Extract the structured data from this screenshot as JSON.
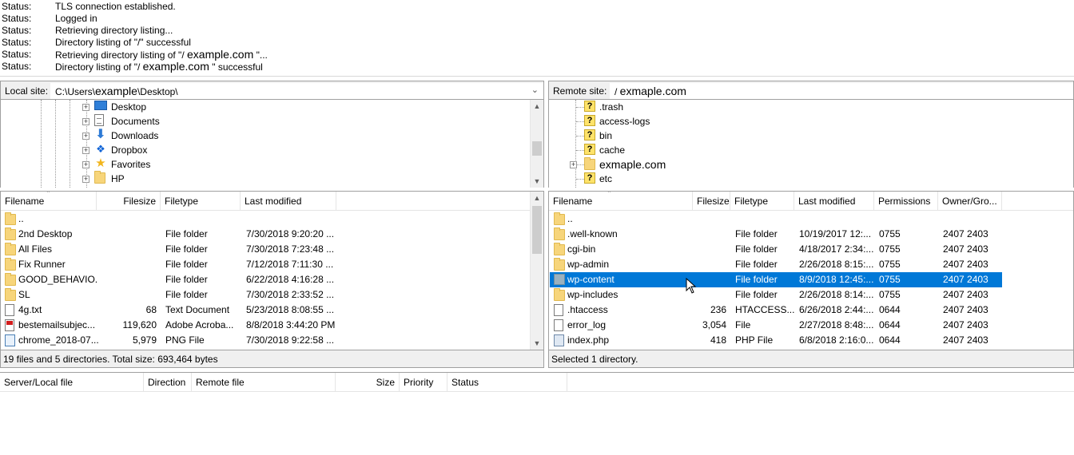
{
  "log": [
    {
      "label": "Status:",
      "msg": "TLS connection established."
    },
    {
      "label": "Status:",
      "msg": "Logged in"
    },
    {
      "label": "Status:",
      "msg": "Retrieving directory listing..."
    },
    {
      "label": "Status:",
      "msg": "Directory listing of \"/\" successful"
    },
    {
      "label": "Status:",
      "pre": "Retrieving directory listing of \"/ ",
      "domain": "example.com",
      "post": "  \"..."
    },
    {
      "label": "Status:",
      "pre": "Directory listing of \"/ ",
      "domain": "example.com",
      "post": "  \" successful"
    }
  ],
  "local": {
    "site_label": "Local site:",
    "path_prefix": "C:\\Users\\",
    "path_user": "example",
    "path_suffix": "\\Desktop\\",
    "tree": [
      {
        "name": "Desktop",
        "icon": "desktop-icon"
      },
      {
        "name": "Documents",
        "icon": "document-icon"
      },
      {
        "name": "Downloads",
        "icon": "download-icon"
      },
      {
        "name": "Dropbox",
        "icon": "dropbox-icon"
      },
      {
        "name": "Favorites",
        "icon": "star-icon"
      },
      {
        "name": "HP",
        "icon": "folder-icon"
      }
    ],
    "columns": [
      "Filename",
      "Filesize",
      "Filetype",
      "Last modified"
    ],
    "files": [
      {
        "name": "..",
        "size": "",
        "type": "",
        "modified": "",
        "icon": "folder-icon"
      },
      {
        "name": "2nd Desktop",
        "size": "",
        "type": "File folder",
        "modified": "7/30/2018 9:20:20 ...",
        "icon": "folder-icon"
      },
      {
        "name": "All Files",
        "size": "",
        "type": "File folder",
        "modified": "7/30/2018 7:23:48 ...",
        "icon": "folder-icon"
      },
      {
        "name": "Fix Runner",
        "size": "",
        "type": "File folder",
        "modified": "7/12/2018 7:11:30 ...",
        "icon": "folder-icon"
      },
      {
        "name": "GOOD_BEHAVIO...",
        "size": "",
        "type": "File folder",
        "modified": "6/22/2018 4:16:28 ...",
        "icon": "folder-icon"
      },
      {
        "name": "SL",
        "size": "",
        "type": "File folder",
        "modified": "7/30/2018 2:33:52 ...",
        "icon": "folder-icon"
      },
      {
        "name": "4g.txt",
        "size": "68",
        "type": "Text Document",
        "modified": "5/23/2018 8:08:55 ...",
        "icon": "text-file-icon"
      },
      {
        "name": "bestemailsubjec...",
        "size": "119,620",
        "type": "Adobe Acroba...",
        "modified": "8/8/2018 3:44:20 PM",
        "icon": "pdf-file-icon"
      },
      {
        "name": "chrome_2018-07...",
        "size": "5,979",
        "type": "PNG File",
        "modified": "7/30/2018 9:22:58 ...",
        "icon": "image-file-icon"
      }
    ],
    "status": "19 files and 5 directories. Total size: 693,464 bytes"
  },
  "remote": {
    "site_label": "Remote site:",
    "path_prefix": "/ ",
    "path_domain": "exmaple.com",
    "tree": [
      {
        "name": ".trash",
        "icon": "unknown-icon"
      },
      {
        "name": "access-logs",
        "icon": "unknown-icon"
      },
      {
        "name": "bin",
        "icon": "unknown-icon"
      },
      {
        "name": "cache",
        "icon": "unknown-icon"
      },
      {
        "name": "exmaple.com",
        "icon": "folder-icon"
      },
      {
        "name": "etc",
        "icon": "unknown-icon"
      }
    ],
    "columns": [
      "Filename",
      "Filesize",
      "Filetype",
      "Last modified",
      "Permissions",
      "Owner/Gro..."
    ],
    "files": [
      {
        "name": "..",
        "size": "",
        "type": "",
        "modified": "",
        "perms": "",
        "owner": "",
        "icon": "folder-icon"
      },
      {
        "name": ".well-known",
        "size": "",
        "type": "File folder",
        "modified": "10/19/2017 12:...",
        "perms": "0755",
        "owner": "2407 2403",
        "icon": "folder-icon"
      },
      {
        "name": "cgi-bin",
        "size": "",
        "type": "File folder",
        "modified": "4/18/2017 2:34:...",
        "perms": "0755",
        "owner": "2407 2403",
        "icon": "folder-icon"
      },
      {
        "name": "wp-admin",
        "size": "",
        "type": "File folder",
        "modified": "2/26/2018 8:15:...",
        "perms": "0755",
        "owner": "2407 2403",
        "icon": "folder-icon"
      },
      {
        "name": "wp-content",
        "size": "",
        "type": "File folder",
        "modified": "8/9/2018 12:45:...",
        "perms": "0755",
        "owner": "2407 2403",
        "icon": "folder-icon",
        "selected": true
      },
      {
        "name": "wp-includes",
        "size": "",
        "type": "File folder",
        "modified": "2/26/2018 8:14:...",
        "perms": "0755",
        "owner": "2407 2403",
        "icon": "folder-icon"
      },
      {
        "name": ".htaccess",
        "size": "236",
        "type": "HTACCESS...",
        "modified": "6/26/2018 2:44:...",
        "perms": "0644",
        "owner": "2407 2403",
        "icon": "text-file-icon"
      },
      {
        "name": "error_log",
        "size": "3,054",
        "type": "File",
        "modified": "2/27/2018 8:48:...",
        "perms": "0644",
        "owner": "2407 2403",
        "icon": "text-file-icon"
      },
      {
        "name": "index.php",
        "size": "418",
        "type": "PHP File",
        "modified": "6/8/2018 2:16:0...",
        "perms": "0644",
        "owner": "2407 2403",
        "icon": "php-file-icon"
      }
    ],
    "status": "Selected 1 directory."
  },
  "queue": {
    "columns": [
      "Server/Local file",
      "Direction",
      "Remote file",
      "Size",
      "Priority",
      "Status"
    ]
  },
  "colors": {
    "selection": "#0078d7",
    "folder": "#f7d57b",
    "panel_bg": "#f0f0f0"
  }
}
